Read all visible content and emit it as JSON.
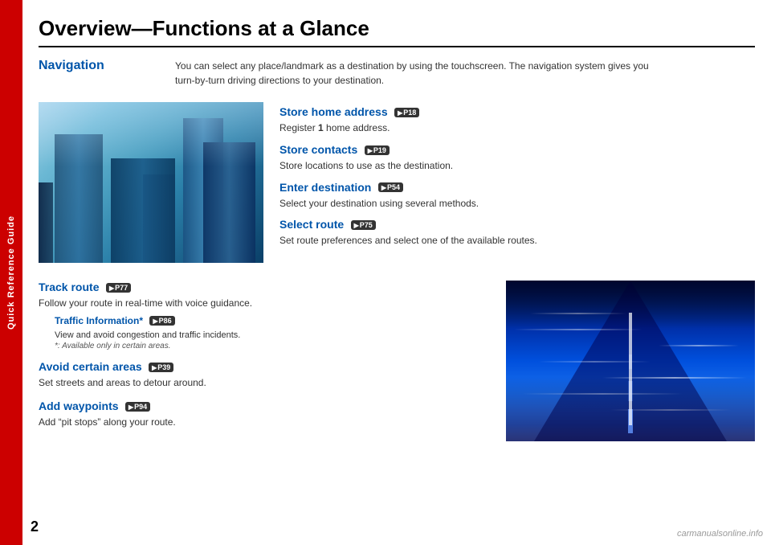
{
  "left_tab": {
    "text": "Quick Reference Guide"
  },
  "page_number": "2",
  "watermark": "carmanualsonline.info",
  "page_title": "Overview—Functions at a Glance",
  "navigation_section": {
    "label": "Navigation",
    "description_line1": "You can select any place/landmark as a destination by using the touchscreen. The navigation system gives you",
    "description_line2": "turn-by-turn driving directions to your destination."
  },
  "top_features": [
    {
      "title": "Store home address",
      "badge": "P18",
      "description": "Register 1 home address."
    },
    {
      "title": "Store contacts",
      "badge": "P19",
      "description": "Store locations to use as the destination."
    },
    {
      "title": "Enter destination",
      "badge": "P54",
      "description": "Select your destination using several methods."
    },
    {
      "title": "Select route",
      "badge": "P75",
      "description": "Set route preferences and select one of the available routes."
    }
  ],
  "bottom_features": [
    {
      "title": "Track route",
      "badge": "P77",
      "description": "Follow your route in real-time with voice guidance.",
      "sub_feature": {
        "title": "Traffic Information*",
        "badge": "P86",
        "description": "View and avoid congestion and traffic incidents.",
        "note": "*: Available only in certain areas."
      }
    },
    {
      "title": "Avoid certain areas",
      "badge": "P39",
      "description": "Set streets and areas to detour around."
    },
    {
      "title": "Add waypoints",
      "badge": "P94",
      "description": "Add “pit stops” along your route."
    }
  ]
}
